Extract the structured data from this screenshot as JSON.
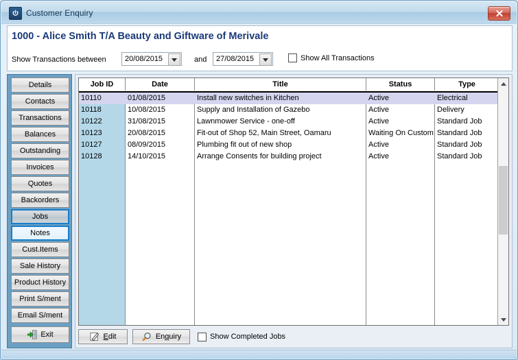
{
  "window": {
    "title": "Customer Enquiry",
    "app_icon": "power-icon",
    "close_label": "✖"
  },
  "header": {
    "customer_title": "1000 - Alice Smith T/A Beauty and Giftware of Merivale",
    "filter": {
      "label_between": "Show Transactions between",
      "date_from": "20/08/2015",
      "date_to": "27/08/2015",
      "label_and": "and",
      "show_all_label": "Show All Transactions",
      "show_all_checked": false
    }
  },
  "sidebar": {
    "items": [
      {
        "label": "Details",
        "state": "normal"
      },
      {
        "label": "Contacts",
        "state": "normal"
      },
      {
        "label": "Transactions",
        "state": "normal"
      },
      {
        "label": "Balances",
        "state": "normal"
      },
      {
        "label": "Outstanding",
        "state": "normal"
      },
      {
        "label": "Invoices",
        "state": "normal"
      },
      {
        "label": "Quotes",
        "state": "normal"
      },
      {
        "label": "Backorders",
        "state": "normal"
      },
      {
        "label": "Jobs",
        "state": "selected"
      },
      {
        "label": "Notes",
        "state": "hover"
      },
      {
        "label": "Cust.Items",
        "state": "normal"
      },
      {
        "label": "Sale History",
        "state": "normal"
      },
      {
        "label": "Product History",
        "state": "normal"
      },
      {
        "label": "Print S/ment",
        "state": "normal"
      },
      {
        "label": "Email S/ment",
        "state": "normal"
      }
    ],
    "exit": {
      "label": "Exit",
      "icon": "exit-door-icon"
    }
  },
  "grid": {
    "columns": [
      {
        "label": "Job ID"
      },
      {
        "label": "Date"
      },
      {
        "label": "Title"
      },
      {
        "label": "Status"
      },
      {
        "label": "Type"
      }
    ],
    "rows": [
      {
        "job_id": "10110",
        "date": "01/08/2015",
        "title": "Install new switches in Kitchen",
        "status": "Active",
        "type": "Electrical",
        "selected": true
      },
      {
        "job_id": "10118",
        "date": "10/08/2015",
        "title": "Supply and Installation of Gazebo",
        "status": "Active",
        "type": "Delivery",
        "selected": false
      },
      {
        "job_id": "10122",
        "date": "31/08/2015",
        "title": "Lawnmower Service - one-off",
        "status": "Active",
        "type": "Standard Job",
        "selected": false
      },
      {
        "job_id": "10123",
        "date": "20/08/2015",
        "title": "Fit-out of Shop 52, Main Street, Oamaru",
        "status": "Waiting On Customer",
        "type": "Standard Job",
        "selected": false
      },
      {
        "job_id": "10127",
        "date": "08/09/2015",
        "title": "Plumbing fit out of new shop",
        "status": "Active",
        "type": "Standard Job",
        "selected": false
      },
      {
        "job_id": "10128",
        "date": "14/10/2015",
        "title": "Arrange Consents for building project",
        "status": "Active",
        "type": "Standard Job",
        "selected": false
      }
    ],
    "scrollbar": {
      "up_icon": "chevron-up-icon",
      "down_icon": "chevron-down-icon"
    }
  },
  "toolbar": {
    "edit_label": "Edit",
    "edit_accel": "E",
    "edit_icon": "pencil-edit-icon",
    "enquiry_label": "Enquiry",
    "enquiry_accel": "q",
    "enquiry_icon": "magnifier-icon",
    "show_completed_label": "Show Completed Jobs",
    "show_completed_checked": false
  },
  "colors": {
    "accent_blue": "#1a7ec8",
    "sidebar_bg": "#6ba0c4",
    "title_text": "#1b3a78",
    "id_column_bg": "#b4d8e8",
    "selected_row_bg": "#d5d5f0",
    "close_red": "#c1402f"
  }
}
